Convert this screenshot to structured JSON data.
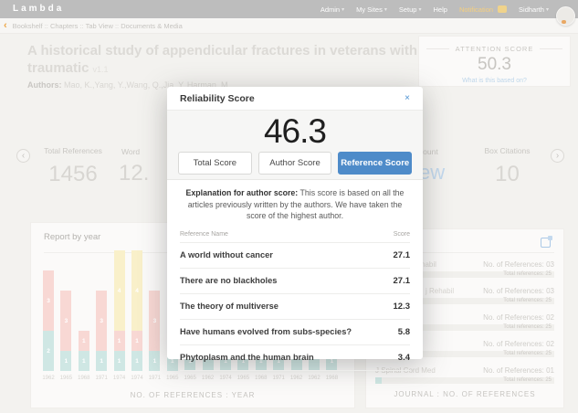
{
  "colors": {
    "accent_blue": "#4e8bc9",
    "notification_yellow": "#f5cf7e",
    "bar_teal": "#cfe7e4",
    "bar_pink": "#f8d8d4",
    "bar_yellow": "#f9f0ca"
  },
  "icons": {
    "back": "‹",
    "caret_down": "▾",
    "close": "×",
    "prev": "‹",
    "next": "›",
    "journal_panel_icon": "report-toggle-icon"
  },
  "navbar": {
    "brand": "Lambda",
    "items": [
      {
        "label": "Admin",
        "caret": true
      },
      {
        "label": "My Sites",
        "caret": true
      },
      {
        "label": "Setup",
        "caret": true
      },
      {
        "label": "Help",
        "caret": false
      },
      {
        "label": "Notification",
        "caret": false,
        "highlight": true,
        "badge": ""
      },
      {
        "label": "Sidharth",
        "caret": true
      }
    ]
  },
  "breadcrumb": {
    "separator": "::",
    "items": [
      "Bookshelf",
      "Chapters",
      "Tab View",
      "Documents & Media"
    ]
  },
  "document": {
    "title_line1": "A historical study of appendicular fractures in veterans with",
    "title_line2": "traumatic",
    "version": "v1.1",
    "authors_label": "Authors:",
    "authors": "Mao, K.,Yang, Y.,Wang, Q.,Jia, Y.,Harman, M."
  },
  "attention": {
    "label": "ATTENTION SCORE",
    "value": "50.3",
    "link": "What is this based on?"
  },
  "stats": {
    "items": [
      {
        "label": "Total References",
        "value": "1456"
      },
      {
        "label": "Word",
        "value": "12."
      },
      {
        "label": "Count",
        "value": "ew"
      },
      {
        "label": "Box Citations",
        "value": "10"
      }
    ]
  },
  "modal": {
    "title": "Reliability Score",
    "score": "46.3",
    "tabs": [
      {
        "label": "Total Score",
        "active": false
      },
      {
        "label": "Author Score",
        "active": false
      },
      {
        "label": "Reference Score",
        "active": true
      }
    ],
    "explanation_bold": "Explanation for author score:",
    "explanation_rest": " This score is based on all the articles previously written by the authors. We have taken the score of the highest author.",
    "table": {
      "col_name": "Reference Name",
      "col_score": "Score",
      "rows": [
        {
          "name": "A world without cancer",
          "score": "27.1"
        },
        {
          "name": "There are no blackholes",
          "score": "27.1"
        },
        {
          "name": "The theory of multiverse",
          "score": "12.3"
        },
        {
          "name": "Have humans evolved from subs-species?",
          "score": "5.8"
        },
        {
          "name": "Phytoplasm and the human brain",
          "score": "3.4"
        }
      ]
    }
  },
  "report_panel": {
    "title": "Report by year",
    "caption": "NO. OF REFERENCES : YEAR"
  },
  "journal_panel": {
    "caption": "JOURNAL : NO. OF REFERENCES",
    "rows": [
      {
        "name": "habil",
        "refs": "No. of References: 03",
        "bar_text": "Total references: 25"
      },
      {
        "name": "j Rehabil",
        "refs": "No. of References: 03",
        "bar_text": "Total references: 25"
      },
      {
        "name": "",
        "refs": "No. of References: 02",
        "bar_text": "Total references: 25"
      },
      {
        "name": "",
        "refs": "No. of References: 02",
        "bar_text": "Total references: 25"
      },
      {
        "name": "J Spinal Cord Med",
        "refs": "No. of References: 01",
        "bar_text": "Total references: 25"
      }
    ]
  },
  "chart_data": {
    "type": "bar",
    "stacked": true,
    "title": "Report by year",
    "xlabel": "NO. OF REFERENCES : YEAR",
    "categories": [
      "1962",
      "1965",
      "1968",
      "1971",
      "1974",
      "1974",
      "1971",
      "1965",
      "1965",
      "1962",
      "1974",
      "1965",
      "1968",
      "1971",
      "1962",
      "1962",
      "1968"
    ],
    "series": [
      {
        "name": "teal",
        "color": "#cfe7e4",
        "values": [
          2,
          1,
          1,
          1,
          1,
          1,
          1,
          1,
          1,
          3,
          1,
          1,
          1,
          1,
          3,
          3,
          1
        ]
      },
      {
        "name": "pink",
        "color": "#f8d8d4",
        "values": [
          3,
          3,
          1,
          3,
          1,
          1,
          3,
          2,
          2,
          1,
          2,
          2,
          2,
          2,
          1,
          1,
          2
        ]
      },
      {
        "name": "yellow",
        "color": "#f9f0ca",
        "values": [
          0,
          0,
          0,
          0,
          4,
          4,
          0,
          0,
          0,
          0,
          0,
          0,
          0,
          0,
          0,
          0,
          0
        ]
      }
    ]
  }
}
